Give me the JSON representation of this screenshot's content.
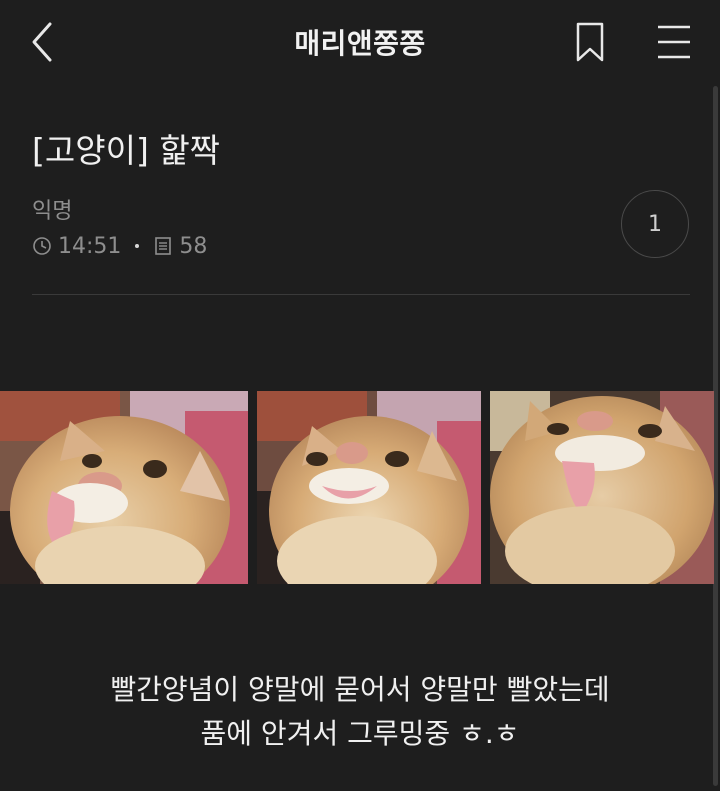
{
  "header": {
    "title": "매리앤쫑쫑"
  },
  "post": {
    "title": "[고양이] 핥짝",
    "author": "익명",
    "time": "14:51",
    "views": "58",
    "comment_count": "1"
  },
  "body": {
    "lines": [
      "빨간양념이 양말에 묻어서 양말만 빨았는데",
      "품에 안겨서 그루밍중 ㅎ.ㅎ"
    ]
  },
  "icons": {
    "back": "chevron-left-icon",
    "bookmark": "bookmark-icon",
    "menu": "hamburger-menu-icon",
    "time": "clock-icon",
    "views": "document-icon"
  },
  "colors": {
    "background": "#1e1e1e",
    "text_primary": "#f0f0f0",
    "text_secondary": "#8e8e8e",
    "divider": "#3a3a3a"
  }
}
